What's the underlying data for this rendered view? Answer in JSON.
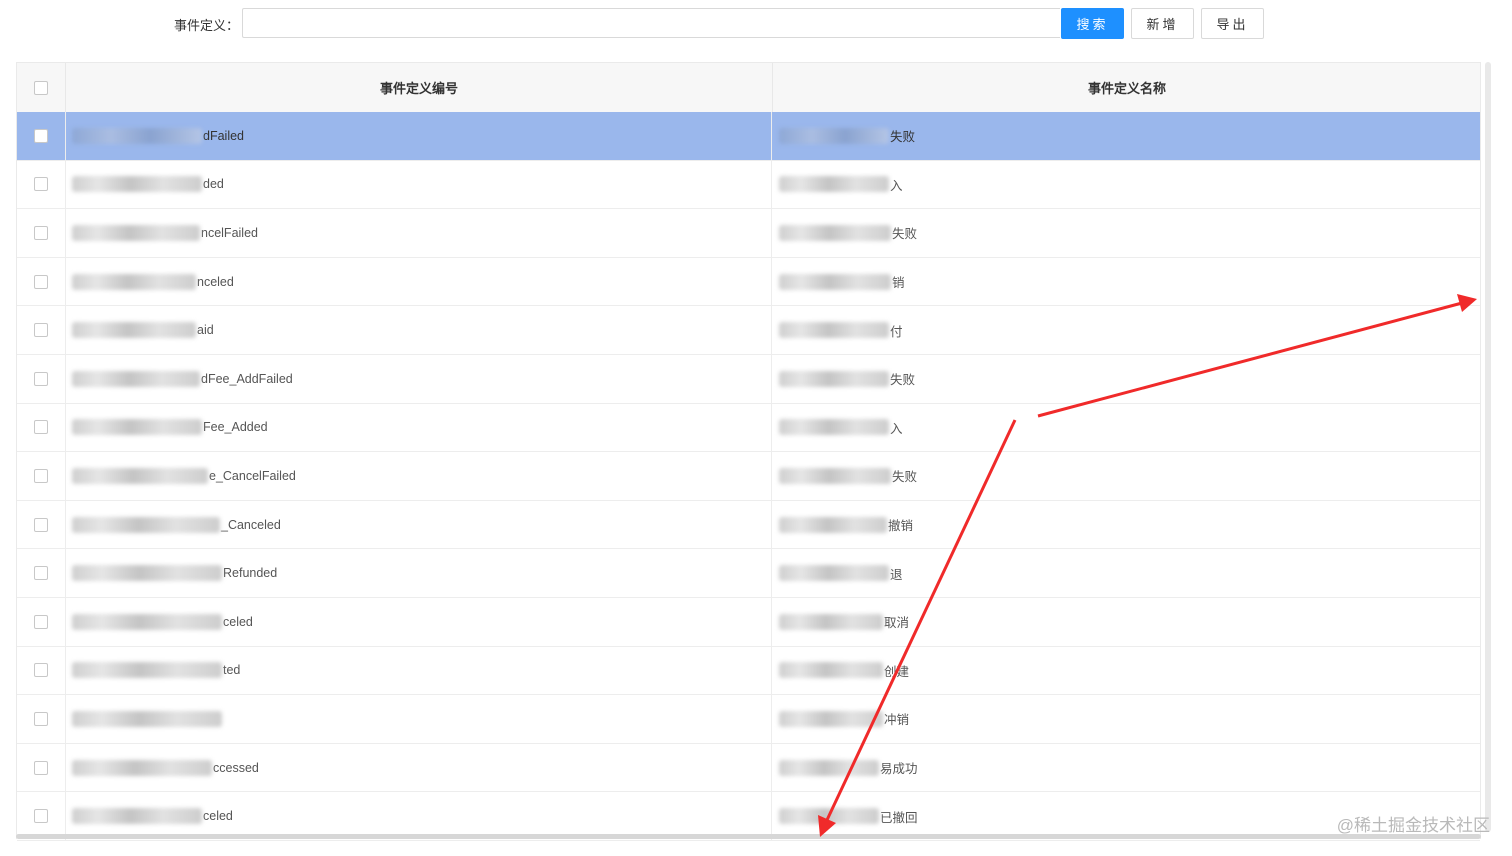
{
  "search": {
    "label": "事件定义：",
    "value": "",
    "placeholder": ""
  },
  "buttons": {
    "search": "搜索",
    "add": "新增",
    "export": "导出"
  },
  "table": {
    "columns": [
      "事件定义编号",
      "事件定义名称"
    ],
    "selected_row_index": 0,
    "rows": [
      {
        "code_visible": "dFailed",
        "name_visible": "失败"
      },
      {
        "code_visible": "ded",
        "name_visible": "入"
      },
      {
        "code_visible": "ncelFailed",
        "name_visible": "失败"
      },
      {
        "code_visible": "nceled",
        "name_visible": "销"
      },
      {
        "code_visible": "aid",
        "name_visible": "付"
      },
      {
        "code_visible": "dFee_AddFailed",
        "name_visible": "失败"
      },
      {
        "code_visible": "Fee_Added",
        "name_visible": "入"
      },
      {
        "code_visible": "e_CancelFailed",
        "name_visible": "失败"
      },
      {
        "code_visible": "_Canceled",
        "name_visible": "撤销"
      },
      {
        "code_visible": "Refunded",
        "name_visible": "退"
      },
      {
        "code_visible": "celed",
        "name_visible": "取消"
      },
      {
        "code_visible": "ted",
        "name_visible": "创建"
      },
      {
        "code_visible": "",
        "name_visible": "冲销"
      },
      {
        "code_visible": "ccessed",
        "name_visible": "易成功"
      },
      {
        "code_visible": "celed",
        "name_visible": "已撤回"
      }
    ]
  },
  "annotation": {
    "color": "#f02a2a"
  },
  "watermark": "@稀土掘金技术社区"
}
